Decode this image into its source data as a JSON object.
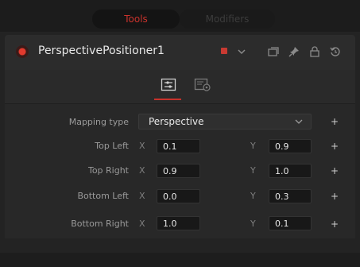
{
  "tabs": {
    "tools": "Tools",
    "modifiers": "Modifiers"
  },
  "node": {
    "title": "PerspectivePositioner1",
    "enabled": true,
    "swatch_color": "#c83a32"
  },
  "subtabs": [
    {
      "icon": "controls-icon",
      "active": true
    },
    {
      "icon": "settings-icon",
      "active": false
    }
  ],
  "mapping": {
    "label": "Mapping type",
    "value": "Perspective"
  },
  "corners": [
    {
      "label": "Top Left",
      "x_label": "X",
      "x": "0.1",
      "y_label": "Y",
      "y": "0.9"
    },
    {
      "label": "Top Right",
      "x_label": "X",
      "x": "0.9",
      "y_label": "Y",
      "y": "1.0"
    },
    {
      "label": "Bottom Left",
      "x_label": "X",
      "x": "0.0",
      "y_label": "Y",
      "y": "0.3"
    },
    {
      "label": "Bottom Right",
      "x_label": "X",
      "x": "1.0",
      "y_label": "Y",
      "y": "0.1"
    }
  ],
  "colors": {
    "accent": "#c8322c",
    "background": "#232323"
  }
}
